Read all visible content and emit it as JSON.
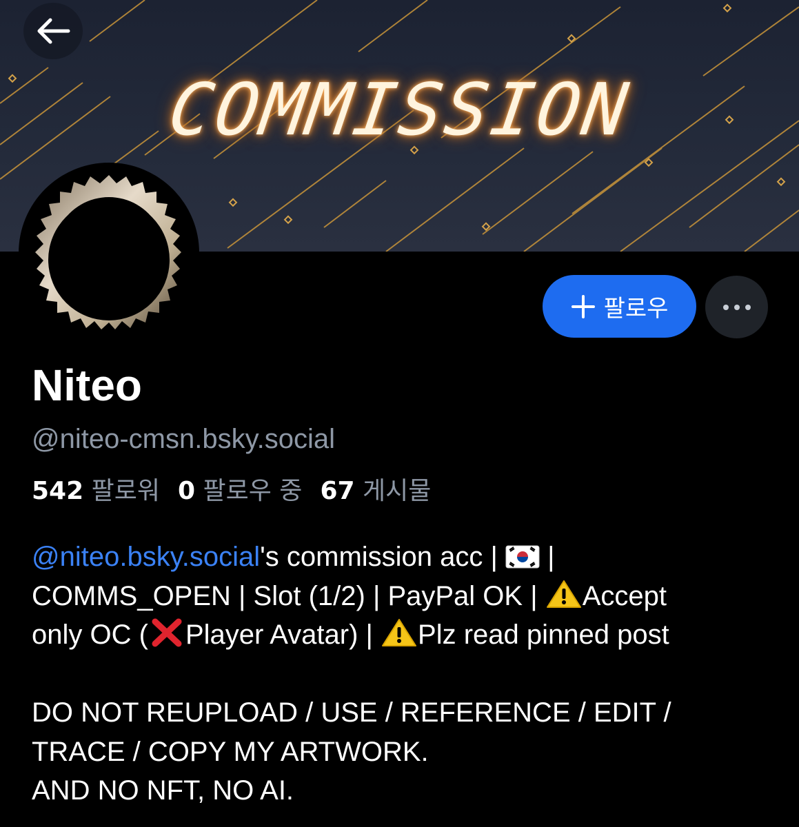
{
  "banner": {
    "title": "COMMISSION"
  },
  "nav": {
    "back_icon": "arrow-left-icon"
  },
  "actions": {
    "follow_label": "팔로우",
    "follow_icon": "plus-icon",
    "more_icon": "ellipsis-icon"
  },
  "profile": {
    "display_name": "Niteo",
    "handle": "@niteo-cmsn.bsky.social",
    "followers_count": "542",
    "followers_label": "팔로워",
    "following_count": "0",
    "following_label": "팔로우 중",
    "posts_count": "67",
    "posts_label": "게시물"
  },
  "bio": {
    "mention": "@niteo.bsky.social",
    "line1_rest": "'s commission acc | ",
    "line1_after_flag": " |",
    "line2_a": "COMMS_OPEN | Slot (1/2)  | PayPal OK | ",
    "line2_b": "Accept",
    "line3_a": "only OC (",
    "line3_b": "Player Avatar) | ",
    "line3_c": "Plz read pinned post",
    "line4": "DO NOT REUPLOAD / USE / REFERENCE / EDIT /",
    "line5": "TRACE / COPY MY ARTWORK.",
    "line6": "AND NO NFT, NO AI.",
    "flag_icon": "south-korea-flag-icon",
    "warning_icon": "warning-icon",
    "cross_icon": "red-x-icon"
  },
  "colors": {
    "accent": "#1e6cf0",
    "mention": "#3b82f6",
    "muted_text": "#8e98a6",
    "background": "#000000"
  }
}
